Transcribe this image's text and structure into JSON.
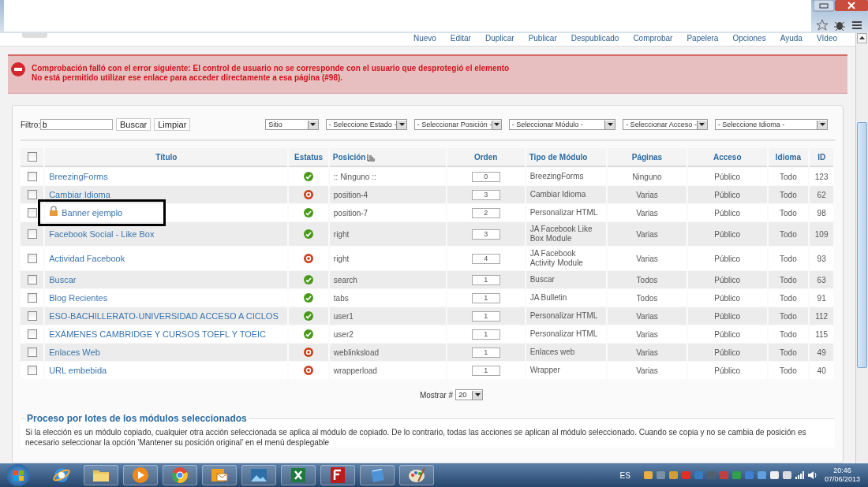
{
  "toolbar": [
    "Nuevo",
    "Editar",
    "Duplicar",
    "Publicar",
    "Despublicado",
    "Comprobar",
    "Papelera",
    "Opciones",
    "Ayuda",
    "Vídeo"
  ],
  "alert": {
    "lines": [
      "Comprobación falló con el error siguiente: El control de usuario no se corresponde con el usuario que desprotegió el elemento",
      "No está permitido utilizar ese enlace para acceder directamente a esa página (#98)."
    ]
  },
  "filter": {
    "label": "Filtro:",
    "value": "b",
    "buttons": [
      "Buscar",
      "Limpiar"
    ],
    "selects": [
      "Sitio",
      "- Seleccione Estado -",
      "- Seleccionar Posición -",
      "- Seleccionar Módulo -",
      "- Seleccionar Acceso -",
      "- Seleccione Idioma -"
    ]
  },
  "table": {
    "select_all": {
      "checked": false
    },
    "columns": [
      {
        "label": "Título",
        "sorted": false
      },
      {
        "label": "Estatus",
        "sorted": false
      },
      {
        "label": "Posición",
        "sorted": true
      },
      {
        "label": "Orden",
        "sorted": false
      },
      {
        "label": "Tipo de Módulo",
        "sorted": false
      },
      {
        "label": "Páginas",
        "sorted": false
      },
      {
        "label": "Acceso",
        "sorted": false
      },
      {
        "label": "Idioma",
        "sorted": false
      },
      {
        "label": "ID",
        "sorted": false
      }
    ],
    "rows": [
      {
        "checked": false,
        "highlighted": false,
        "locked": false,
        "title": "BreezingForms",
        "published": true,
        "position": ":: Ninguno ::",
        "order": "0",
        "type": "BreezingForms",
        "pages": "Ninguno",
        "access": "Público",
        "language": "Todo",
        "id": "123"
      },
      {
        "checked": false,
        "highlighted": false,
        "locked": false,
        "title": "Cambiar Idioma",
        "published": false,
        "position": "position-4",
        "order": "3",
        "type": "Cambiar Idioma",
        "pages": "Varias",
        "access": "Público",
        "language": "Todo",
        "id": "62"
      },
      {
        "checked": false,
        "highlighted": true,
        "locked": true,
        "title": "Banner ejemplo",
        "published": true,
        "position": "position-7",
        "order": "2",
        "type": "Personalizar HTML",
        "pages": "Varias",
        "access": "Público",
        "language": "Todo",
        "id": "98"
      },
      {
        "checked": false,
        "highlighted": false,
        "locked": false,
        "title": "Facebook Social - Like Box",
        "published": true,
        "position": "right",
        "order": "3",
        "type": "JA Facebook Like Box Module",
        "pages": "Varias",
        "access": "Público",
        "language": "Todo",
        "id": "109"
      },
      {
        "checked": false,
        "highlighted": false,
        "locked": false,
        "title": "Actividad Facebook",
        "published": false,
        "position": "right",
        "order": "4",
        "type": "JA Facebook Activity Module",
        "pages": "Varias",
        "access": "Público",
        "language": "Todo",
        "id": "93"
      },
      {
        "checked": false,
        "highlighted": false,
        "locked": false,
        "title": "Buscar",
        "published": true,
        "position": "search",
        "order": "1",
        "type": "Buscar",
        "pages": "Todos",
        "access": "Público",
        "language": "Todo",
        "id": "63"
      },
      {
        "checked": false,
        "highlighted": false,
        "locked": false,
        "title": "Blog Recientes",
        "published": true,
        "position": "tabs",
        "order": "1",
        "type": "JA Bulletin",
        "pages": "Todos",
        "access": "Público",
        "language": "Todo",
        "id": "91"
      },
      {
        "checked": false,
        "highlighted": false,
        "locked": false,
        "title": "ESO-BACHILLERATO-UNIVERSIDAD ACCESO A CICLOS",
        "published": true,
        "position": "user1",
        "order": "1",
        "type": "Personalizar HTML",
        "pages": "Varias",
        "access": "Público",
        "language": "Todo",
        "id": "112"
      },
      {
        "checked": false,
        "highlighted": false,
        "locked": false,
        "title": "EXÁMENES CAMBRIDGE Y CURSOS TOEFL Y TOEIC",
        "published": true,
        "position": "user2",
        "order": "1",
        "type": "Personalizar HTML",
        "pages": "Varias",
        "access": "Público",
        "language": "Todo",
        "id": "115"
      },
      {
        "checked": false,
        "highlighted": false,
        "locked": false,
        "title": "Enlaces Web",
        "published": false,
        "position": "weblinksload",
        "order": "1",
        "type": "Enlaces web",
        "pages": "Varias",
        "access": "Público",
        "language": "Todo",
        "id": "49"
      },
      {
        "checked": false,
        "highlighted": false,
        "locked": false,
        "title": "URL embebida",
        "published": false,
        "position": "wrapperload",
        "order": "1",
        "type": "Wrapper",
        "pages": "Varias",
        "access": "Público",
        "language": "Todo",
        "id": "40"
      }
    ]
  },
  "pagination": {
    "label": "Mostrar #",
    "value": "20"
  },
  "batch": {
    "legend": "Proceso por lotes de los módulos seleccionados",
    "text": "Si la elección es un módulo copiado, cualquier otra acción seleccionada se aplica al módulo de copiado. De lo contrario, todas las acciones se aplican al módulo seleccionado. Cuando se copia y no se cambia de posición es necesario seleccionar la opción 'Mantener su posición original' en el menú desplegable"
  },
  "taskbar": {
    "apps": [
      {
        "kind": "globe"
      },
      {
        "kind": "folder"
      },
      {
        "kind": "media"
      },
      {
        "kind": "chrome"
      },
      {
        "kind": "mail"
      },
      {
        "kind": "photo"
      },
      {
        "kind": "sheet"
      },
      {
        "kind": "ftp"
      },
      {
        "kind": "notebook"
      },
      {
        "kind": "palette"
      }
    ],
    "language": "ES",
    "time": "20:46",
    "date": "07/06/2013"
  }
}
